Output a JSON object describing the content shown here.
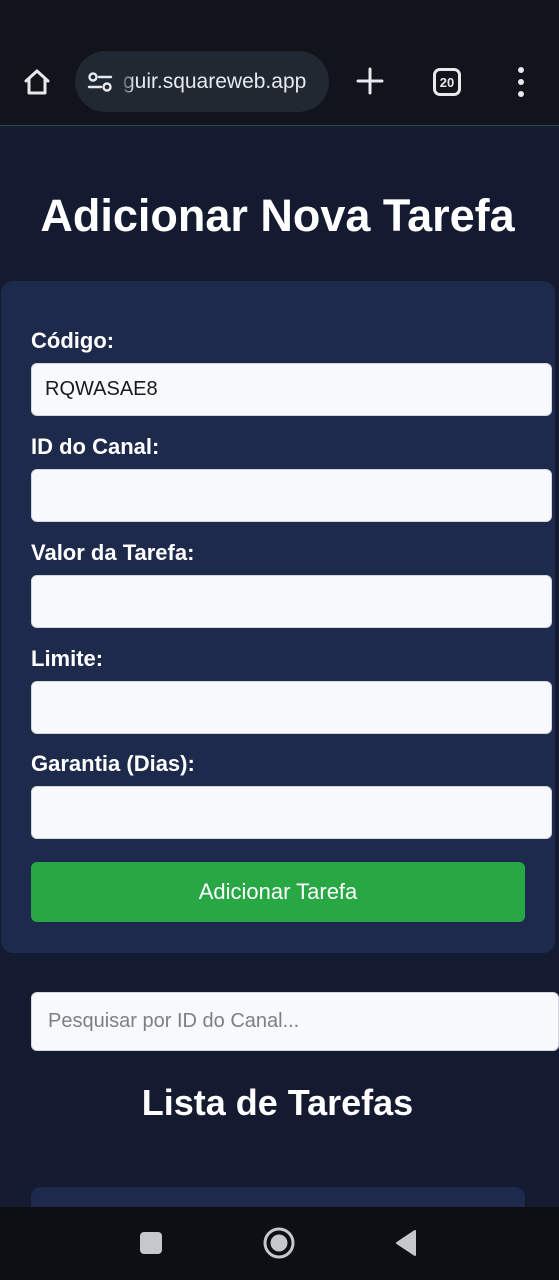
{
  "browser": {
    "url": "guir.squareweb.app",
    "tab_count": "20"
  },
  "page": {
    "title": "Adicionar Nova Tarefa"
  },
  "form": {
    "fields": [
      {
        "label": "Código:",
        "value": "RQWASAE8",
        "placeholder": ""
      },
      {
        "label": "ID do Canal:",
        "value": "",
        "placeholder": ""
      },
      {
        "label": "Valor da Tarefa:",
        "value": "",
        "placeholder": ""
      },
      {
        "label": "Limite:",
        "value": "",
        "placeholder": ""
      },
      {
        "label": "Garantia (Dias):",
        "value": "",
        "placeholder": ""
      }
    ],
    "submit_label": "Adicionar Tarefa"
  },
  "search": {
    "placeholder": "Pesquisar por ID do Canal...",
    "value": ""
  },
  "list": {
    "title": "Lista de Tarefas"
  },
  "colors": {
    "page_background": "#141b30",
    "card_background": "#1e2a4b",
    "accent_button": "#28a745",
    "input_background": "#f8f9fc"
  },
  "icons": {
    "home": "home-icon",
    "site_settings": "site-settings-icon",
    "new_tab": "plus-icon",
    "tabs": "tab-switcher-icon",
    "menu": "more-vert-icon",
    "recents": "recents-square-icon",
    "system_home": "circle-home-icon",
    "back": "back-triangle-icon"
  }
}
